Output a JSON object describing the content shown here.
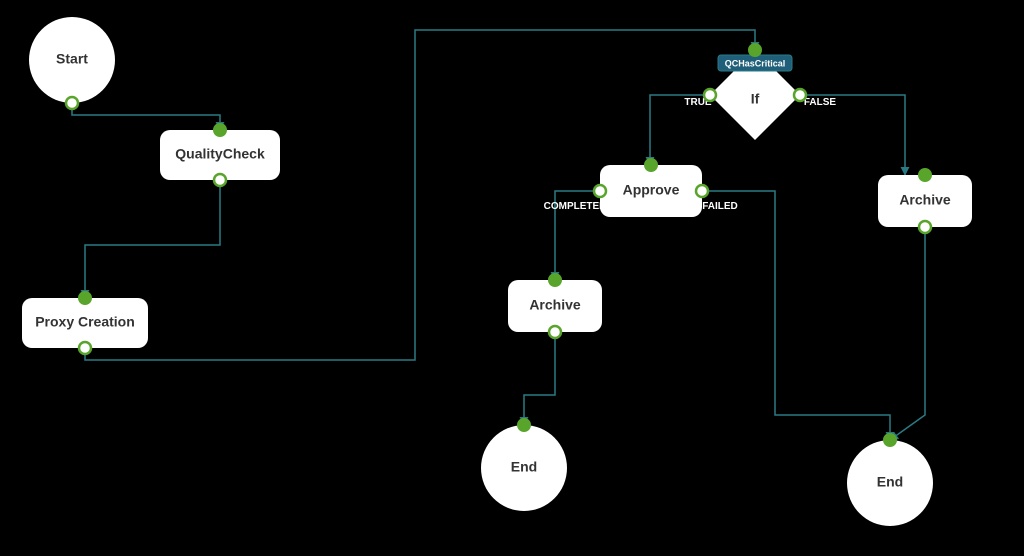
{
  "colors": {
    "edge": "#2a7a85",
    "port_stroke": "#59a52c",
    "port_fill_open": "#ffffff",
    "port_fill_solid": "#59a52c",
    "badge_fill": "#1f5f79",
    "badge_stroke": "#2a7a85"
  },
  "nodes": {
    "start": {
      "label": "Start"
    },
    "qualitycheck": {
      "label": "QualityCheck"
    },
    "proxycreation": {
      "label": "Proxy Creation"
    },
    "if": {
      "label": "If",
      "badge": "QCHasCritical"
    },
    "approve": {
      "label": "Approve"
    },
    "archive_l": {
      "label": "Archive"
    },
    "archive_r": {
      "label": "Archive"
    },
    "end_l": {
      "label": "End"
    },
    "end_r": {
      "label": "End"
    }
  },
  "edge_labels": {
    "if_true": "TRUE",
    "if_false": "FALSE",
    "approve_completed": "COMPLETED",
    "approve_failed": "FAILED"
  }
}
